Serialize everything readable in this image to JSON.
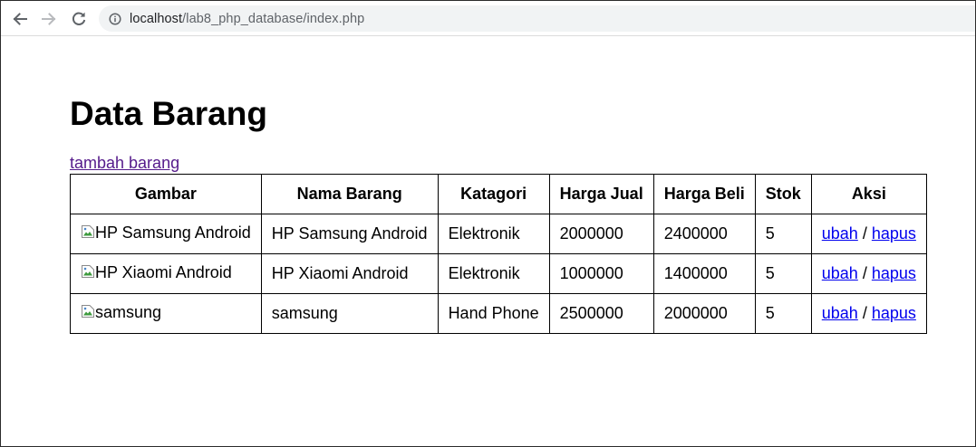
{
  "browser": {
    "url_host": "localhost",
    "url_path": "/lab8_php_database/index.php"
  },
  "page": {
    "title": "Data Barang",
    "add_link": "tambah barang"
  },
  "table": {
    "headers": {
      "gambar": "Gambar",
      "nama": "Nama Barang",
      "kategori": "Katagori",
      "harga_jual": "Harga Jual",
      "harga_beli": "Harga Beli",
      "stok": "Stok",
      "aksi": "Aksi"
    },
    "rows": [
      {
        "gambar_alt": "HP Samsung Android",
        "nama": "HP Samsung Android",
        "kategori": "Elektronik",
        "harga_jual": "2000000",
        "harga_beli": "2400000",
        "stok": "5",
        "ubah": "ubah",
        "sep": "/",
        "hapus": "hapus"
      },
      {
        "gambar_alt": "HP Xiaomi Android",
        "nama": "HP Xiaomi Android",
        "kategori": "Elektronik",
        "harga_jual": "1000000",
        "harga_beli": "1400000",
        "stok": "5",
        "ubah": "ubah",
        "sep": "/",
        "hapus": "hapus"
      },
      {
        "gambar_alt": "samsung",
        "nama": "samsung",
        "kategori": "Hand Phone",
        "harga_jual": "2500000",
        "harga_beli": "2000000",
        "stok": "5",
        "ubah": "ubah",
        "sep": "/",
        "hapus": "hapus"
      }
    ]
  },
  "colors": {
    "visited_link": "#551a8b",
    "link": "#0000ee",
    "omnibox_bg": "#f1f3f4"
  },
  "icons": {
    "back": "back-arrow-icon",
    "forward": "forward-arrow-icon",
    "reload": "reload-icon",
    "info": "info-icon",
    "broken_image": "broken-image-icon"
  }
}
